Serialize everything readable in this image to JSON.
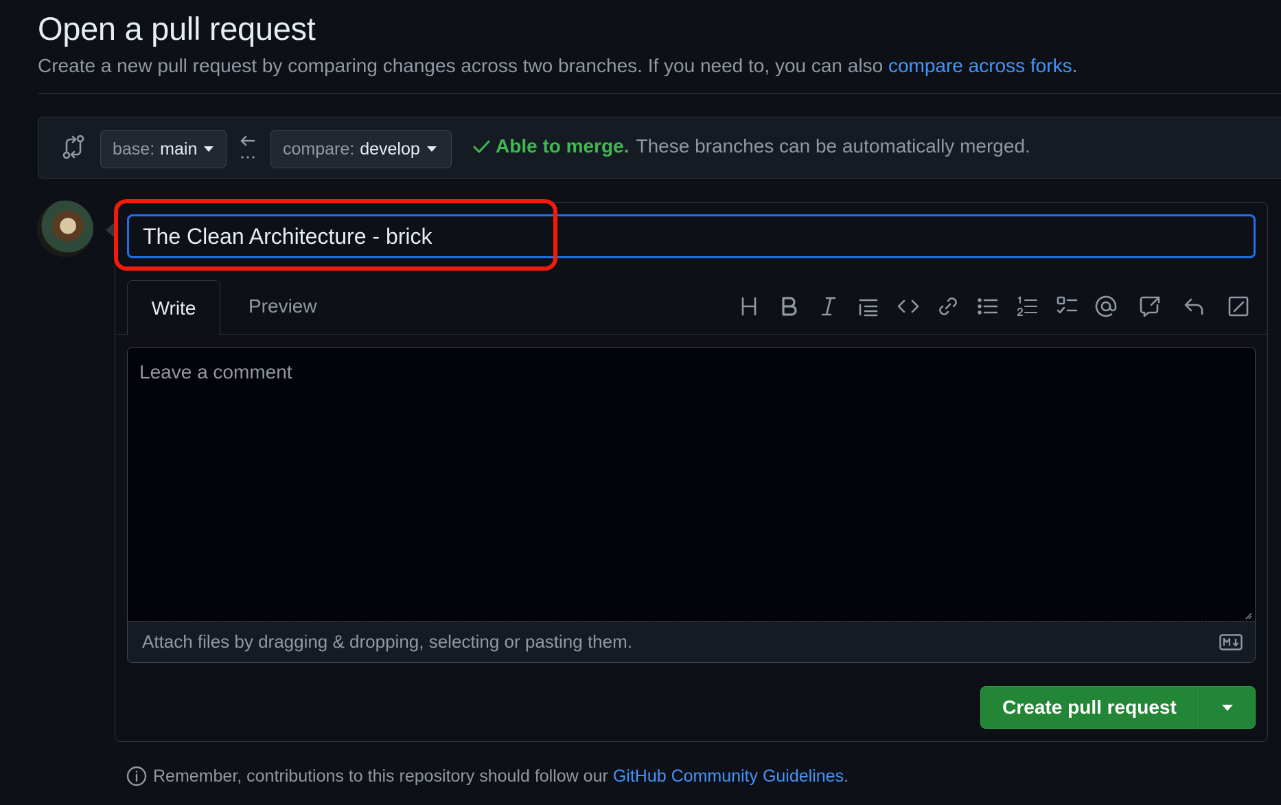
{
  "header": {
    "title": "Open a pull request",
    "subtitle": "Create a new pull request by comparing changes across two branches. If you need to, you can also",
    "forks_link": "compare across forks",
    "subtitle_end": "."
  },
  "range": {
    "base_prefix": "base:",
    "base_branch": "main",
    "compare_prefix": "compare:",
    "compare_branch": "develop",
    "merge_ok": "Able to merge.",
    "merge_text": "These branches can be automatically merged."
  },
  "form": {
    "title_value": "The Clean Architecture - brick",
    "tab_write": "Write",
    "tab_preview": "Preview",
    "comment_placeholder": "Leave a comment",
    "attach_text": "Attach files by dragging & dropping, selecting or pasting them.",
    "create_label": "Create pull request"
  },
  "toolbar": {
    "icons": [
      "heading-icon",
      "bold-icon",
      "italic-icon",
      "quote-icon",
      "code-icon",
      "link-icon",
      "unordered-list-icon",
      "ordered-list-icon",
      "task-list-icon",
      "mention-icon",
      "cross-reference-icon",
      "reply-icon",
      "fullscreen-icon"
    ]
  },
  "footer": {
    "text": "Remember, contributions to this repository should follow our",
    "link": "GitHub Community Guidelines",
    "end": "."
  },
  "colors": {
    "background": "#0d1117",
    "accent_blue": "#4493f8",
    "success_green": "#3fb950",
    "button_green": "#238636",
    "highlight_red": "#f41b0c"
  }
}
